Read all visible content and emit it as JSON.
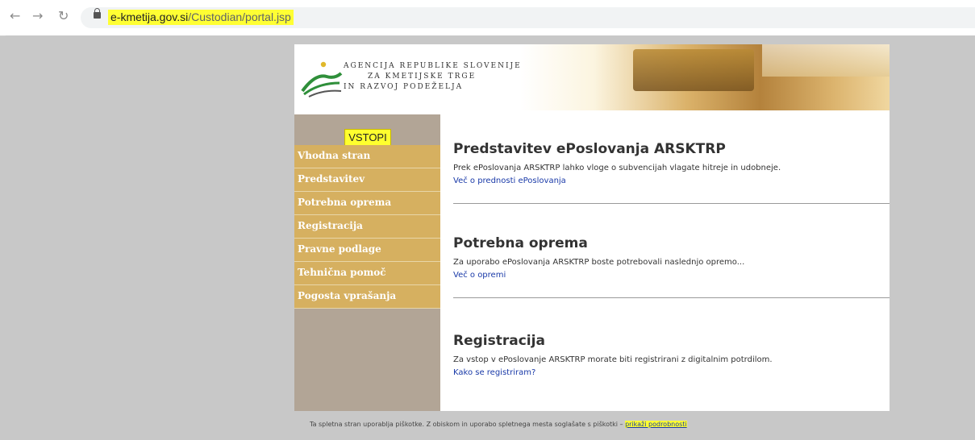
{
  "browser": {
    "url_host": "e-kmetija.gov.si",
    "url_path": "/Custodian/portal.jsp"
  },
  "banner": {
    "agency_line1": "AGENCIJA REPUBLIKE SLOVENIJE",
    "agency_line2": "ZA KMETIJSKE TRGE",
    "agency_line3": "IN RAZVOJ PODEŽELJA"
  },
  "sidebar": {
    "login_label": "VSTOPI",
    "items": [
      {
        "label": "Vhodna stran"
      },
      {
        "label": "Predstavitev"
      },
      {
        "label": "Potrebna oprema"
      },
      {
        "label": "Registracija"
      },
      {
        "label": "Pravne podlage"
      },
      {
        "label": "Tehnična pomoč"
      },
      {
        "label": "Pogosta vprašanja"
      }
    ]
  },
  "sections": [
    {
      "title": "Predstavitev ePoslovanja ARSKTRP",
      "text": "Prek ePoslovanja ARSKTRP lahko vloge o subvencijah vlagate hitreje in udobneje.",
      "link": "Več o prednosti ePoslovanja"
    },
    {
      "title": "Potrebna oprema",
      "text": "Za uporabo ePoslovanja ARSKTRP boste potrebovali naslednjo opremo...",
      "link": "Več o opremi"
    },
    {
      "title": "Registracija",
      "text": "Za vstop v ePoslovanje ARSKTRP morate biti registrirani z digitalnim potrdilom.",
      "link": "Kako se registriram?"
    }
  ],
  "footer": {
    "cookie_text": "Ta spletna stran uporablja piškotke. Z obiskom in uporabo spletnega mesta soglašate s piškotki – ",
    "cookie_link": "prikaži podrobnosti"
  },
  "colors": {
    "sidebar_bg": "#b2a596",
    "nav_item_bg": "#d6b060",
    "highlight": "#ffff33",
    "link": "#1a3aa8"
  },
  "icons": [
    "back-arrow-icon",
    "forward-arrow-icon",
    "reload-icon",
    "lock-icon",
    "agency-logo-icon"
  ]
}
